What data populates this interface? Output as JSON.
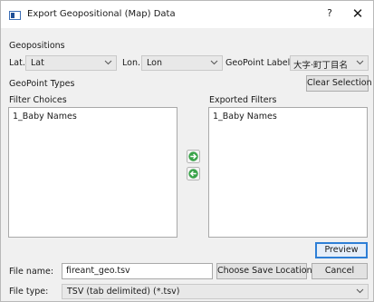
{
  "window": {
    "title": "Export Geopositional (Map) Data",
    "help": "?",
    "close": "✕"
  },
  "geopositions": {
    "section_label": "Geopositions",
    "lat_label": "Lat.",
    "lat_value": "Lat",
    "lon_label": "Lon.",
    "lon_value": "Lon",
    "geopoint_labels_label": "GeoPoint Labels",
    "geopoint_labels_value": "大字·町丁目名"
  },
  "geopoint_types": {
    "section_label": "GeoPoint Types",
    "clear_selection_label": "Clear Selection",
    "filter_choices_label": "Filter Choices",
    "filter_choices_items": [
      "1_Baby Names"
    ],
    "exported_filters_label": "Exported Filters",
    "exported_filters_items": [
      "1_Baby Names"
    ]
  },
  "actions": {
    "preview_label": "Preview",
    "choose_save_location_label": "Choose Save Location",
    "cancel_label": "Cancel"
  },
  "file": {
    "name_label": "File name:",
    "name_value": "fireant_geo.tsv",
    "type_label": "File type:",
    "type_value": "TSV (tab delimited) (*.tsv)"
  },
  "icons": {
    "app": "window-app-icon",
    "move_right": "green-arrow-right-icon",
    "move_left": "green-arrow-left-icon",
    "dropdown": "chevron-down-icon"
  },
  "colors": {
    "arrow_green": "#3aa34a",
    "focus_blue": "#2e7fd6"
  }
}
